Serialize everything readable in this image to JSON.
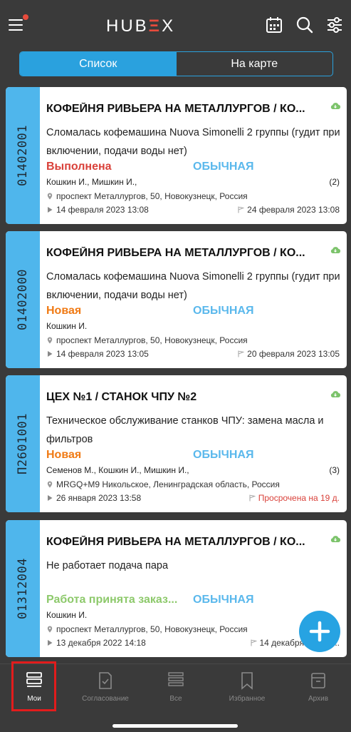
{
  "header": {
    "logo_left": "HUB",
    "logo_accent": "Ξ",
    "logo_right": "X",
    "notification_color": "#e84b3c"
  },
  "segmented": {
    "list_label": "Список",
    "map_label": "На карте",
    "active": "list"
  },
  "tasks": [
    {
      "id": "01402001",
      "title": "КОФЕЙНЯ РИВЬЕРА НА МЕТАЛЛУРГОВ / КО...",
      "description": "Сломалась кофемашина Nuova Simonelli 2 группы (гудит при включении, подачи воды нет)",
      "status": "Выполнена",
      "status_color": "#d9413a",
      "priority": "ОБЫЧНАЯ",
      "people": "Кошкин И., Мишкин И.,",
      "count": "(2)",
      "address": "проспект Металлургов, 50, Новокузнецк, Россия",
      "start": "14 февраля 2023 13:08",
      "end": "24 февраля 2023 13:08"
    },
    {
      "id": "01402000",
      "title": "КОФЕЙНЯ РИВЬЕРА НА МЕТАЛЛУРГОВ / КО...",
      "description": "Сломалась кофемашина Nuova Simonelli 2 группы (гудит при включении, подачи воды нет)",
      "status": "Новая",
      "status_color": "#f07a14",
      "priority": "ОБЫЧНАЯ",
      "people": "Кошкин И.",
      "count": "",
      "address": "проспект Металлургов, 50, Новокузнецк, Россия",
      "start": "14 февраля 2023 13:05",
      "end": "20 февраля 2023 13:05"
    },
    {
      "id": "П2601001",
      "title": "ЦЕХ №1 / СТАНОК ЧПУ №2",
      "description": "Техническое обслуживание станков ЧПУ: замена масла и фильтров",
      "status": "Новая",
      "status_color": "#f07a14",
      "priority": "ОБЫЧНАЯ",
      "people": "Семенов М., Кошкин И., Мишкин И.,",
      "count": "(3)",
      "address": "MRGQ+M9 Никольское, Ленинградская область, Россия",
      "start": "26 января 2023 13:58",
      "end": "Просрочена на 19 д."
    },
    {
      "id": "01312004",
      "title": "КОФЕЙНЯ РИВЬЕРА НА МЕТАЛЛУРГОВ / КО...",
      "description": "Не работает подача пара",
      "status": "Работа принята заказ...",
      "status_color": "#8dc96b",
      "priority": "ОБЫЧНАЯ",
      "people": "Кошкин И.",
      "count": "",
      "address": "проспект Металлургов, 50, Новокузнецк, Россия",
      "start": "13 декабря 2022 14:18",
      "end": "14 декабря 2022 1..."
    }
  ],
  "tabbar": {
    "mine": "Мои",
    "approval": "Согласование",
    "all": "Все",
    "favorites": "Избранное",
    "archive": "Архив",
    "active": "mine"
  },
  "colors": {
    "accent": "#27a3e2",
    "background": "#3a3a3a",
    "priority": "#5ab8ec",
    "overdue": "#d9413a"
  }
}
